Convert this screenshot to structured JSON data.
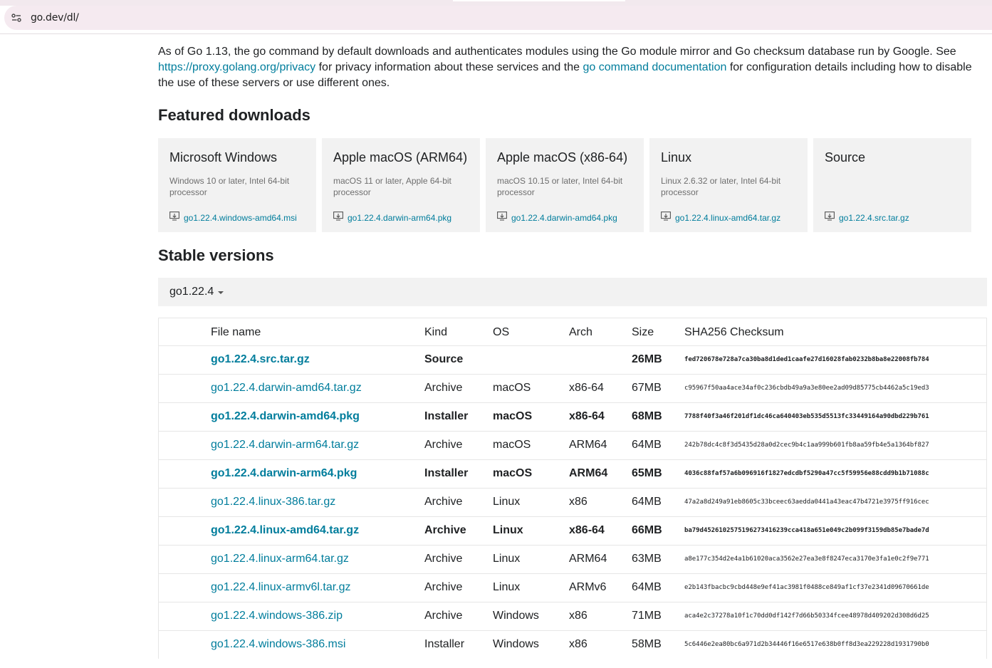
{
  "browser": {
    "url": "go.dev/dl/"
  },
  "intro": {
    "text_before": "As of Go 1.13, the go command by default downloads and authenticates modules using the Go module mirror and Go checksum database run by Google. See ",
    "link1": "https://proxy.golang.org/privacy",
    "text_middle": " for privacy information about these services and the ",
    "link2": "go command documentation",
    "text_after": " for configuration details including how to disable the use of these servers or use different ones."
  },
  "featured": {
    "heading": "Featured downloads",
    "cards": [
      {
        "title": "Microsoft Windows",
        "desc": "Windows 10 or later, Intel 64-bit processor",
        "file": "go1.22.4.windows-amd64.msi"
      },
      {
        "title": "Apple macOS (ARM64)",
        "desc": "macOS 11 or later, Apple 64-bit processor",
        "file": "go1.22.4.darwin-arm64.pkg"
      },
      {
        "title": "Apple macOS (x86-64)",
        "desc": "macOS 10.15 or later, Intel 64-bit processor",
        "file": "go1.22.4.darwin-amd64.pkg"
      },
      {
        "title": "Linux",
        "desc": "Linux 2.6.32 or later, Intel 64-bit processor",
        "file": "go1.22.4.linux-amd64.tar.gz"
      },
      {
        "title": "Source",
        "desc": "",
        "file": "go1.22.4.src.tar.gz"
      }
    ]
  },
  "stable": {
    "heading": "Stable versions",
    "version": "go1.22.4",
    "columns": [
      "File name",
      "Kind",
      "OS",
      "Arch",
      "Size",
      "SHA256 Checksum"
    ],
    "rows": [
      {
        "name": "go1.22.4.src.tar.gz",
        "kind": "Source",
        "os": "",
        "arch": "",
        "size": "26MB",
        "sha": "fed720678e728a7ca30ba8d1ded1caafe27d16028fab0232b8ba8e22008fb784",
        "highlight": true
      },
      {
        "name": "go1.22.4.darwin-amd64.tar.gz",
        "kind": "Archive",
        "os": "macOS",
        "arch": "x86-64",
        "size": "67MB",
        "sha": "c95967f50aa4ace34af0c236cbdb49a9a3e80ee2ad09d85775cb4462a5c19ed3",
        "highlight": false
      },
      {
        "name": "go1.22.4.darwin-amd64.pkg",
        "kind": "Installer",
        "os": "macOS",
        "arch": "x86-64",
        "size": "68MB",
        "sha": "7788f40f3a46f201df1dc46ca640403eb535d5513fc33449164a90dbd229b761",
        "highlight": true
      },
      {
        "name": "go1.22.4.darwin-arm64.tar.gz",
        "kind": "Archive",
        "os": "macOS",
        "arch": "ARM64",
        "size": "64MB",
        "sha": "242b78dc4c8f3d5435d28a0d2cec9b4c1aa999b601fb8aa59fb4e5a1364bf827",
        "highlight": false
      },
      {
        "name": "go1.22.4.darwin-arm64.pkg",
        "kind": "Installer",
        "os": "macOS",
        "arch": "ARM64",
        "size": "65MB",
        "sha": "4036c88faf57a6b096916f1827edcdbf5290a47cc5f59956e88cdd9b1b71088c",
        "highlight": true
      },
      {
        "name": "go1.22.4.linux-386.tar.gz",
        "kind": "Archive",
        "os": "Linux",
        "arch": "x86",
        "size": "64MB",
        "sha": "47a2a8d249a91eb8605c33bceec63aedda0441a43eac47b4721e3975ff916cec",
        "highlight": false
      },
      {
        "name": "go1.22.4.linux-amd64.tar.gz",
        "kind": "Archive",
        "os": "Linux",
        "arch": "x86-64",
        "size": "66MB",
        "sha": "ba79d4526102575196273416239cca418a651e049c2b099f3159db85e7bade7d",
        "highlight": true
      },
      {
        "name": "go1.22.4.linux-arm64.tar.gz",
        "kind": "Archive",
        "os": "Linux",
        "arch": "ARM64",
        "size": "63MB",
        "sha": "a8e177c354d2e4a1b61020aca3562e27ea3e8f8247eca3170e3fa1e0c2f9e771",
        "highlight": false
      },
      {
        "name": "go1.22.4.linux-armv6l.tar.gz",
        "kind": "Archive",
        "os": "Linux",
        "arch": "ARMv6",
        "size": "64MB",
        "sha": "e2b143fbacbc9cbd448e9ef41ac3981f0488ce849af1cf37e2341d09670661de",
        "highlight": false
      },
      {
        "name": "go1.22.4.windows-386.zip",
        "kind": "Archive",
        "os": "Windows",
        "arch": "x86",
        "size": "71MB",
        "sha": "aca4e2c37278a10f1c70dd0df142f7d66b50334fcee48978d409202d308d6d25",
        "highlight": false
      },
      {
        "name": "go1.22.4.windows-386.msi",
        "kind": "Installer",
        "os": "Windows",
        "arch": "x86",
        "size": "58MB",
        "sha": "5c6446e2ea80bc6a971d2b34446f16e6517e638b0ff8d3ea229228d1931790b0",
        "highlight": false
      }
    ]
  }
}
